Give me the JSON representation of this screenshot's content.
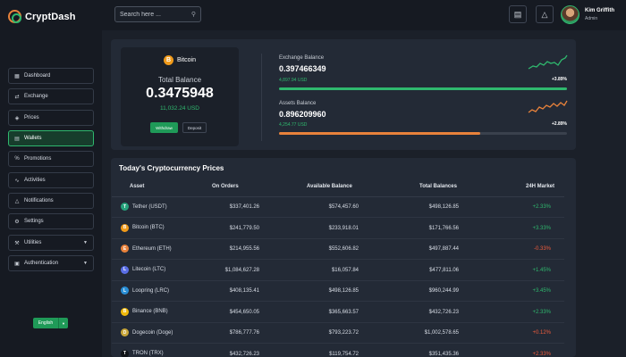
{
  "header": {
    "logo_text": "CryptDash",
    "search_placeholder": "Search here ...",
    "user_name": "Kim Griffith",
    "user_role": "Admin"
  },
  "sidebar": {
    "items": [
      {
        "label": "Dashboard",
        "icon": "grid-icon",
        "active": false,
        "dropdown": false
      },
      {
        "label": "Exchange",
        "icon": "exchange-icon",
        "active": false,
        "dropdown": false
      },
      {
        "label": "Prices",
        "icon": "price-tag-icon",
        "active": false,
        "dropdown": false
      },
      {
        "label": "Wallets",
        "icon": "wallet-icon",
        "active": true,
        "dropdown": false
      },
      {
        "label": "Promotions",
        "icon": "percent-icon",
        "active": false,
        "dropdown": false
      },
      {
        "label": "Activities",
        "icon": "activity-icon",
        "active": false,
        "dropdown": false
      },
      {
        "label": "Notifications",
        "icon": "bell-icon",
        "active": false,
        "dropdown": false
      },
      {
        "label": "Settings",
        "icon": "gear-icon",
        "active": false,
        "dropdown": false
      },
      {
        "label": "Utilities",
        "icon": "tools-icon",
        "active": false,
        "dropdown": true
      },
      {
        "label": "Authentication",
        "icon": "lock-icon",
        "active": false,
        "dropdown": true
      }
    ],
    "language": "English"
  },
  "wallet": {
    "coin": "Bitcoin",
    "total_label": "Total Balance",
    "total_value": "0.3475948",
    "total_usd": "11,032.24 USD",
    "withdraw_label": "Withdraw",
    "deposit_label": "Deposit"
  },
  "balances": {
    "exchange": {
      "label": "Exchange Balance",
      "value": "0.397466349",
      "usd": "4,897.94 USD",
      "change": "+3.89%",
      "progress": 1.0,
      "color": "#2fb86e"
    },
    "assets": {
      "label": "Assets Balance",
      "value": "0.896209960",
      "usd": "4,254.77 USD",
      "change": "+2.89%",
      "progress": 0.7,
      "color": "#e8823b"
    }
  },
  "table": {
    "title": "Today's Cryptocurrency Prices",
    "headers": [
      "Asset",
      "On Orders",
      "Available Balance",
      "Total Balances",
      "24H Market"
    ],
    "rows": [
      {
        "asset": "Tether (USDT)",
        "orders": "$337,401.26",
        "available": "$574,457.60",
        "total": "$498,126.85",
        "market": "+2.33%",
        "positive": true,
        "coin_color": "#26a17b",
        "glyph": "T"
      },
      {
        "asset": "Bitcoin (BTC)",
        "orders": "$241,779.50",
        "available": "$233,918.01",
        "total": "$171,766.56",
        "market": "+3.33%",
        "positive": true,
        "coin_color": "#f09a1a",
        "glyph": "B"
      },
      {
        "asset": "Ethereum (ETH)",
        "orders": "$214,955.56",
        "available": "$552,606.82",
        "total": "$497,887.44",
        "market": "-0.33%",
        "positive": false,
        "coin_color": "#e8823b",
        "glyph": "E"
      },
      {
        "asset": "Litecoin (LTC)",
        "orders": "$1,084,627.28",
        "available": "$16,057.84",
        "total": "$477,811.06",
        "market": "+1.45%",
        "positive": true,
        "coin_color": "#5a6ee6",
        "glyph": "L"
      },
      {
        "asset": "Loopring (LRC)",
        "orders": "$408,135.41",
        "available": "$498,126.85",
        "total": "$960,244.99",
        "market": "+3.45%",
        "positive": true,
        "coin_color": "#2a8fd6",
        "glyph": "L"
      },
      {
        "asset": "Binance (BNB)",
        "orders": "$454,650.05",
        "available": "$365,663.57",
        "total": "$432,726.23",
        "market": "+2.33%",
        "positive": true,
        "coin_color": "#f0b90b",
        "glyph": "B"
      },
      {
        "asset": "Dogecoin (Doge)",
        "orders": "$786,777.76",
        "available": "$793,223.72",
        "total": "$1,002,578.65",
        "market": "+0.12%",
        "positive": false,
        "coin_color": "#c8a63a",
        "glyph": "D"
      },
      {
        "asset": "TRON (TRX)",
        "orders": "$432,726.23",
        "available": "$119,754.72",
        "total": "$351,435.36",
        "market": "+2.33%",
        "positive": false,
        "coin_color": "#111418",
        "glyph": "T"
      }
    ]
  }
}
